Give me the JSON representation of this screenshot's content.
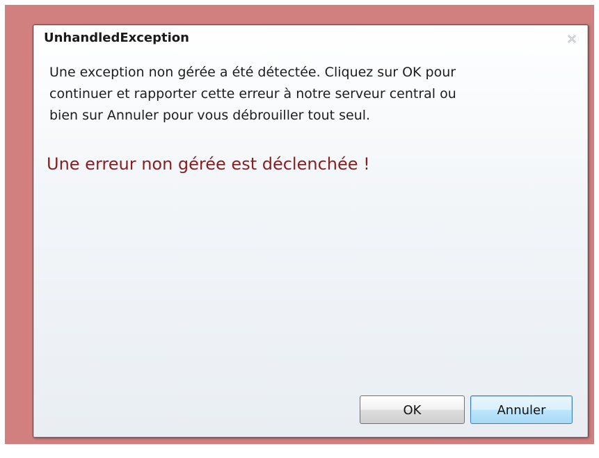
{
  "dialog": {
    "title": "UnhandledException",
    "message": "Une exception non gérée a été détectée. Cliquez sur OK pour\ncontinuer et rapporter cette erreur à notre serveur central ou\nbien sur Annuler pour vous débrouiller tout seul.",
    "error_message": "Une erreur non gérée est déclenchée !",
    "close_icon": "close-icon",
    "buttons": {
      "ok_label": "OK",
      "cancel_label": "Annuler"
    }
  },
  "colors": {
    "backdrop": "#d17f7f",
    "error_text": "#8a1e1e"
  }
}
